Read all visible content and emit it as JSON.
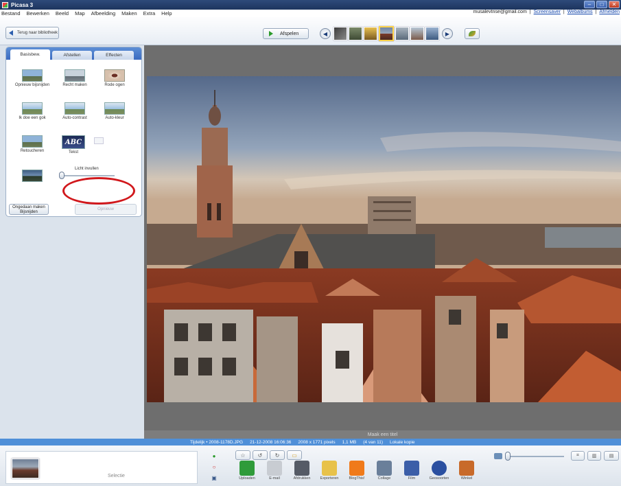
{
  "window": {
    "title": "Picasa 3"
  },
  "menu": {
    "items": [
      "Bestand",
      "Bewerken",
      "Beeld",
      "Map",
      "Afbeelding",
      "Maken",
      "Extra",
      "Help"
    ],
    "email": "musalevtnse@gmail.com",
    "links": [
      "Screensaver",
      "Webalbums",
      "Afmelden"
    ],
    "separator": "|"
  },
  "toolbar": {
    "back_label": "Terug naar bibliotheek",
    "play_label": "Afspelen"
  },
  "edit_panel": {
    "tabs": [
      "Basisbew.",
      "Afstellen",
      "Effecten"
    ],
    "tools": [
      {
        "label": "Opnieuw bijsnijden",
        "icon": "crop-icon"
      },
      {
        "label": "Recht maken",
        "icon": "straighten-icon"
      },
      {
        "label": "Rode ogen",
        "icon": "red-eye-icon"
      },
      {
        "label": "Ik doe een gok",
        "icon": "lucky-icon"
      },
      {
        "label": "Auto-contrast",
        "icon": "auto-contrast-icon"
      },
      {
        "label": "Auto-kleur",
        "icon": "auto-color-icon"
      },
      {
        "label": "Retoucheren",
        "icon": "retouch-icon"
      },
      {
        "label": "Tekst",
        "icon": "text-icon",
        "glyph": "ABC"
      }
    ],
    "fill_light_label": "Licht invullen",
    "fill_light_value": 0,
    "undo_label": "Ongedaan maken Bijsnijden",
    "redo_label": "Opnieuw"
  },
  "viewer": {
    "caption_placeholder": "Maak een titel",
    "info": [
      "Tijdelijk • 2008-1178D.JPG",
      "21-12-2008 16:06:36",
      "2008 x 1771 pixels",
      "1,1 MB",
      "(4 van 11)",
      "Lokale kopie"
    ]
  },
  "tray": {
    "selection_label": "Selectie",
    "actions": [
      {
        "label": "Uploaden",
        "color": "#2f9b3a"
      },
      {
        "label": "E-mail",
        "color": "#c8ccd2"
      },
      {
        "label": "Afdrukken",
        "color": "#555b66"
      },
      {
        "label": "Exporteren",
        "color": "#e8c24a"
      },
      {
        "label": "BlogThis!",
        "color": "#f07a1a"
      },
      {
        "label": "Collage",
        "color": "#6a7f9a"
      },
      {
        "label": "Film",
        "color": "#3b5ea8"
      },
      {
        "label": "Geosoorten",
        "color": "#2a4fa0"
      },
      {
        "label": "Winkel",
        "color": "#c86a2a"
      }
    ]
  },
  "colors": {
    "accent": "#4f8fd8",
    "annotation": "#d1181c",
    "title_bar": "#1d355e"
  }
}
